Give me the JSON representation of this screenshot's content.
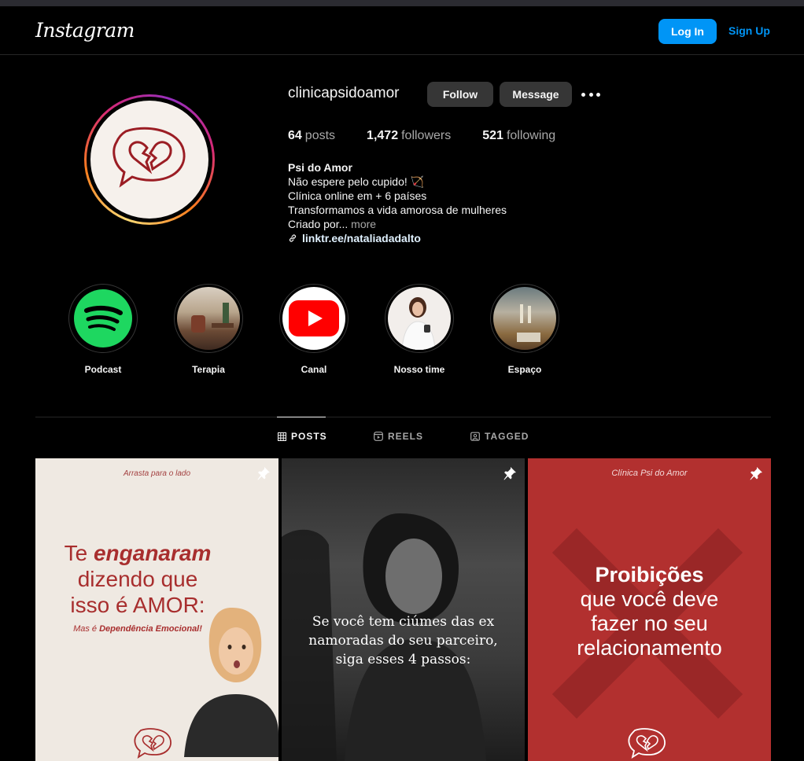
{
  "header": {
    "logo": "Instagram",
    "login_label": "Log In",
    "signup_label": "Sign Up"
  },
  "profile": {
    "username": "clinicapsidoamor",
    "follow_label": "Follow",
    "message_label": "Message",
    "stats": {
      "posts_count": "64",
      "posts_label": "posts",
      "followers_count": "1,472",
      "followers_label": "followers",
      "following_count": "521",
      "following_label": "following"
    },
    "bio": {
      "name": "Psi do Amor",
      "line1": "Não espere pelo cupido! 🏹",
      "line2": "Clínica online em + 6 países",
      "line3": "Transformamos a vida amorosa de mulheres",
      "line4": "Criado por...",
      "more": "more",
      "link": "linktr.ee/nataliadadalto"
    }
  },
  "highlights": [
    {
      "label": "Podcast",
      "icon": "spotify-icon"
    },
    {
      "label": "Terapia",
      "icon": "photo-office"
    },
    {
      "label": "Canal",
      "icon": "youtube-icon"
    },
    {
      "label": "Nosso time",
      "icon": "photo-person"
    },
    {
      "label": "Espaço",
      "icon": "photo-room"
    }
  ],
  "tabs": {
    "posts": "POSTS",
    "reels": "REELS",
    "tagged": "TAGGED"
  },
  "posts": [
    {
      "top_text": "Arrasta para o lado",
      "headline_pre": "Te ",
      "headline_bold": "enganaram",
      "headline_line2": "dizendo que",
      "headline_line3": "isso é AMOR:",
      "sub_pre": "Mas é ",
      "sub_bold": "Dependência Emocional!"
    },
    {
      "caption_line1": "Se você tem ciúmes das ex",
      "caption_line2": "namoradas do seu parceiro,",
      "caption_line3": "siga esses 4 passos:"
    },
    {
      "top_text": "Clínica Psi do Amor",
      "headline_bold": "Proibições",
      "headline_line2": "que você deve",
      "headline_line3": "fazer no seu",
      "headline_line4": "relacionamento"
    }
  ],
  "colors": {
    "brand_blue": "#0095f6",
    "brand_red": "#a82e2e",
    "post3_bg": "#b2302f"
  }
}
